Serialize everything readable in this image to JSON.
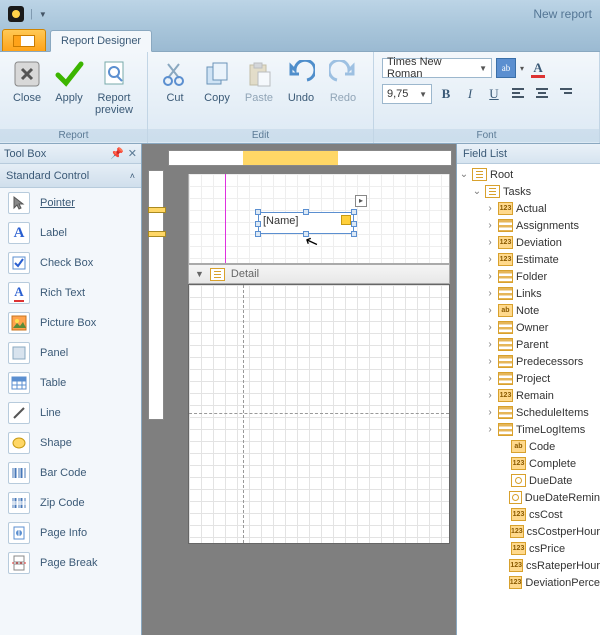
{
  "titlebar": {
    "title": "New report"
  },
  "tabs": {
    "designer": "Report Designer"
  },
  "ribbon": {
    "groups": {
      "report": "Report",
      "edit": "Edit",
      "font": "Font"
    },
    "close": "Close",
    "apply": "Apply",
    "preview": "Report\npreview",
    "cut": "Cut",
    "copy": "Copy",
    "paste": "Paste",
    "undo": "Undo",
    "redo": "Redo",
    "font_name": "Times New Roman",
    "font_size": "9,75"
  },
  "toolbox": {
    "title": "Tool Box",
    "category": "Standard Control",
    "items": [
      {
        "label": "Pointer"
      },
      {
        "label": "Label"
      },
      {
        "label": "Check Box"
      },
      {
        "label": "Rich Text"
      },
      {
        "label": "Picture Box"
      },
      {
        "label": "Panel"
      },
      {
        "label": "Table"
      },
      {
        "label": "Line"
      },
      {
        "label": "Shape"
      },
      {
        "label": "Bar Code"
      },
      {
        "label": "Zip Code"
      },
      {
        "label": "Page Info"
      },
      {
        "label": "Page Break"
      }
    ]
  },
  "design": {
    "detail_label": "Detail",
    "selected_text": "[Name]"
  },
  "fieldlist": {
    "title": "Field List",
    "root": "Root",
    "tasks": "Tasks",
    "fields": [
      {
        "label": "Actual",
        "kind": "num"
      },
      {
        "label": "Assignments",
        "kind": "table"
      },
      {
        "label": "Deviation",
        "kind": "num"
      },
      {
        "label": "Estimate",
        "kind": "num"
      },
      {
        "label": "Folder",
        "kind": "table"
      },
      {
        "label": "Links",
        "kind": "table"
      },
      {
        "label": "Note",
        "kind": "txt"
      },
      {
        "label": "Owner",
        "kind": "table"
      },
      {
        "label": "Parent",
        "kind": "table"
      },
      {
        "label": "Predecessors",
        "kind": "table"
      },
      {
        "label": "Project",
        "kind": "table"
      },
      {
        "label": "Remain",
        "kind": "num"
      },
      {
        "label": "ScheduleItems",
        "kind": "table"
      },
      {
        "label": "TimeLogItems",
        "kind": "table"
      }
    ],
    "subfields": [
      {
        "label": "Code",
        "kind": "txt"
      },
      {
        "label": "Complete",
        "kind": "num"
      },
      {
        "label": "DueDate",
        "kind": "date"
      },
      {
        "label": "DueDateRemin",
        "kind": "date"
      },
      {
        "label": "csCost",
        "kind": "num"
      },
      {
        "label": "csCostperHour",
        "kind": "num"
      },
      {
        "label": "csPrice",
        "kind": "num"
      },
      {
        "label": "csRateperHour",
        "kind": "num"
      },
      {
        "label": "DeviationPerce",
        "kind": "num"
      }
    ]
  }
}
